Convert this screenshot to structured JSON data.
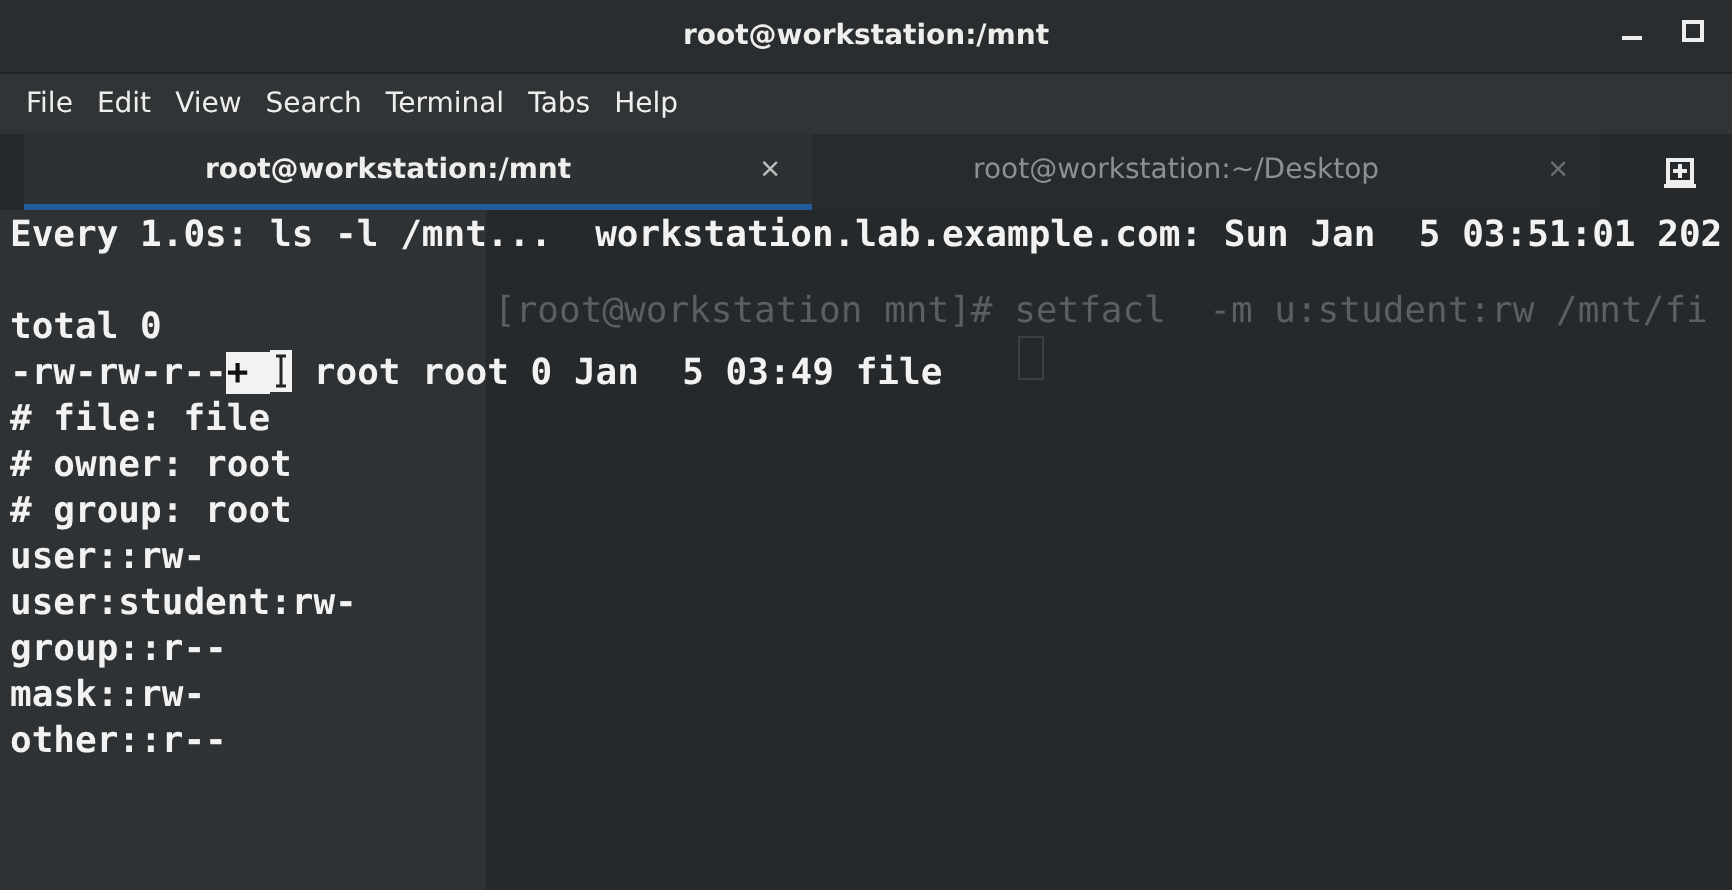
{
  "window": {
    "title": "root@workstation:/mnt"
  },
  "menu": [
    "File",
    "Edit",
    "View",
    "Search",
    "Terminal",
    "Tabs",
    "Help"
  ],
  "tabs": [
    {
      "label": "root@workstation:/mnt",
      "close": "×",
      "selected": true
    },
    {
      "label": "root@workstation:~/Desktop",
      "close": "×",
      "selected": false
    }
  ],
  "background_window": {
    "lines": [
      "[root@workstation mnt]# setfacl  -m u:student:rw /mnt/fi"
    ]
  },
  "terminal": {
    "lines": [
      {
        "kind": "text",
        "text": "Every 1.0s: ls -l /mnt...  workstation.lab.example.com: Sun Jan  5 03:51:01 202"
      },
      {
        "kind": "blank"
      },
      {
        "kind": "text",
        "text": "total 0"
      },
      {
        "kind": "selection",
        "before": "-rw-rw-r--",
        "selected": "+ ",
        "after": " root root 0 Jan  5 03:49 file"
      },
      {
        "kind": "text",
        "text": "# file: file"
      },
      {
        "kind": "text",
        "text": "# owner: root"
      },
      {
        "kind": "text",
        "text": "# group: root"
      },
      {
        "kind": "text",
        "text": "user::rw-"
      },
      {
        "kind": "text",
        "text": "user:student:rw-"
      },
      {
        "kind": "text",
        "text": "group::r--"
      },
      {
        "kind": "text",
        "text": "mask::rw-"
      },
      {
        "kind": "text",
        "text": "other::r--"
      }
    ]
  }
}
